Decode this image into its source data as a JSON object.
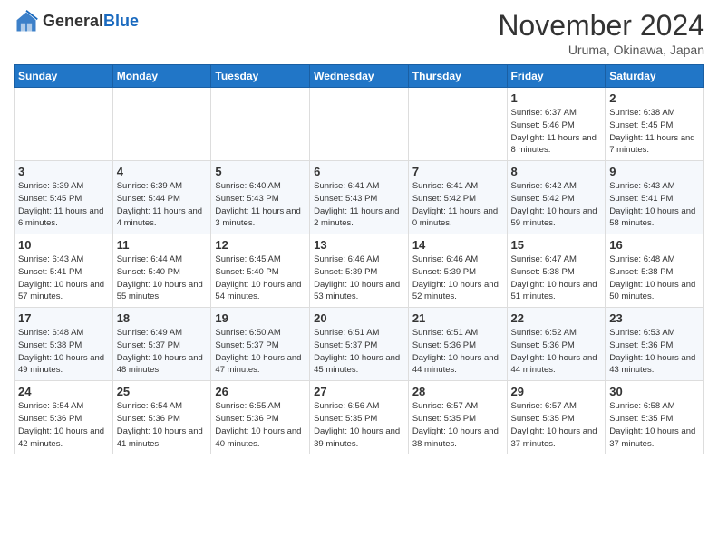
{
  "header": {
    "logo_general": "General",
    "logo_blue": "Blue",
    "month_title": "November 2024",
    "location": "Uruma, Okinawa, Japan"
  },
  "days_of_week": [
    "Sunday",
    "Monday",
    "Tuesday",
    "Wednesday",
    "Thursday",
    "Friday",
    "Saturday"
  ],
  "weeks": [
    [
      {
        "day": "",
        "info": ""
      },
      {
        "day": "",
        "info": ""
      },
      {
        "day": "",
        "info": ""
      },
      {
        "day": "",
        "info": ""
      },
      {
        "day": "",
        "info": ""
      },
      {
        "day": "1",
        "info": "Sunrise: 6:37 AM\nSunset: 5:46 PM\nDaylight: 11 hours and 8 minutes."
      },
      {
        "day": "2",
        "info": "Sunrise: 6:38 AM\nSunset: 5:45 PM\nDaylight: 11 hours and 7 minutes."
      }
    ],
    [
      {
        "day": "3",
        "info": "Sunrise: 6:39 AM\nSunset: 5:45 PM\nDaylight: 11 hours and 6 minutes."
      },
      {
        "day": "4",
        "info": "Sunrise: 6:39 AM\nSunset: 5:44 PM\nDaylight: 11 hours and 4 minutes."
      },
      {
        "day": "5",
        "info": "Sunrise: 6:40 AM\nSunset: 5:43 PM\nDaylight: 11 hours and 3 minutes."
      },
      {
        "day": "6",
        "info": "Sunrise: 6:41 AM\nSunset: 5:43 PM\nDaylight: 11 hours and 2 minutes."
      },
      {
        "day": "7",
        "info": "Sunrise: 6:41 AM\nSunset: 5:42 PM\nDaylight: 11 hours and 0 minutes."
      },
      {
        "day": "8",
        "info": "Sunrise: 6:42 AM\nSunset: 5:42 PM\nDaylight: 10 hours and 59 minutes."
      },
      {
        "day": "9",
        "info": "Sunrise: 6:43 AM\nSunset: 5:41 PM\nDaylight: 10 hours and 58 minutes."
      }
    ],
    [
      {
        "day": "10",
        "info": "Sunrise: 6:43 AM\nSunset: 5:41 PM\nDaylight: 10 hours and 57 minutes."
      },
      {
        "day": "11",
        "info": "Sunrise: 6:44 AM\nSunset: 5:40 PM\nDaylight: 10 hours and 55 minutes."
      },
      {
        "day": "12",
        "info": "Sunrise: 6:45 AM\nSunset: 5:40 PM\nDaylight: 10 hours and 54 minutes."
      },
      {
        "day": "13",
        "info": "Sunrise: 6:46 AM\nSunset: 5:39 PM\nDaylight: 10 hours and 53 minutes."
      },
      {
        "day": "14",
        "info": "Sunrise: 6:46 AM\nSunset: 5:39 PM\nDaylight: 10 hours and 52 minutes."
      },
      {
        "day": "15",
        "info": "Sunrise: 6:47 AM\nSunset: 5:38 PM\nDaylight: 10 hours and 51 minutes."
      },
      {
        "day": "16",
        "info": "Sunrise: 6:48 AM\nSunset: 5:38 PM\nDaylight: 10 hours and 50 minutes."
      }
    ],
    [
      {
        "day": "17",
        "info": "Sunrise: 6:48 AM\nSunset: 5:38 PM\nDaylight: 10 hours and 49 minutes."
      },
      {
        "day": "18",
        "info": "Sunrise: 6:49 AM\nSunset: 5:37 PM\nDaylight: 10 hours and 48 minutes."
      },
      {
        "day": "19",
        "info": "Sunrise: 6:50 AM\nSunset: 5:37 PM\nDaylight: 10 hours and 47 minutes."
      },
      {
        "day": "20",
        "info": "Sunrise: 6:51 AM\nSunset: 5:37 PM\nDaylight: 10 hours and 45 minutes."
      },
      {
        "day": "21",
        "info": "Sunrise: 6:51 AM\nSunset: 5:36 PM\nDaylight: 10 hours and 44 minutes."
      },
      {
        "day": "22",
        "info": "Sunrise: 6:52 AM\nSunset: 5:36 PM\nDaylight: 10 hours and 44 minutes."
      },
      {
        "day": "23",
        "info": "Sunrise: 6:53 AM\nSunset: 5:36 PM\nDaylight: 10 hours and 43 minutes."
      }
    ],
    [
      {
        "day": "24",
        "info": "Sunrise: 6:54 AM\nSunset: 5:36 PM\nDaylight: 10 hours and 42 minutes."
      },
      {
        "day": "25",
        "info": "Sunrise: 6:54 AM\nSunset: 5:36 PM\nDaylight: 10 hours and 41 minutes."
      },
      {
        "day": "26",
        "info": "Sunrise: 6:55 AM\nSunset: 5:36 PM\nDaylight: 10 hours and 40 minutes."
      },
      {
        "day": "27",
        "info": "Sunrise: 6:56 AM\nSunset: 5:35 PM\nDaylight: 10 hours and 39 minutes."
      },
      {
        "day": "28",
        "info": "Sunrise: 6:57 AM\nSunset: 5:35 PM\nDaylight: 10 hours and 38 minutes."
      },
      {
        "day": "29",
        "info": "Sunrise: 6:57 AM\nSunset: 5:35 PM\nDaylight: 10 hours and 37 minutes."
      },
      {
        "day": "30",
        "info": "Sunrise: 6:58 AM\nSunset: 5:35 PM\nDaylight: 10 hours and 37 minutes."
      }
    ]
  ]
}
